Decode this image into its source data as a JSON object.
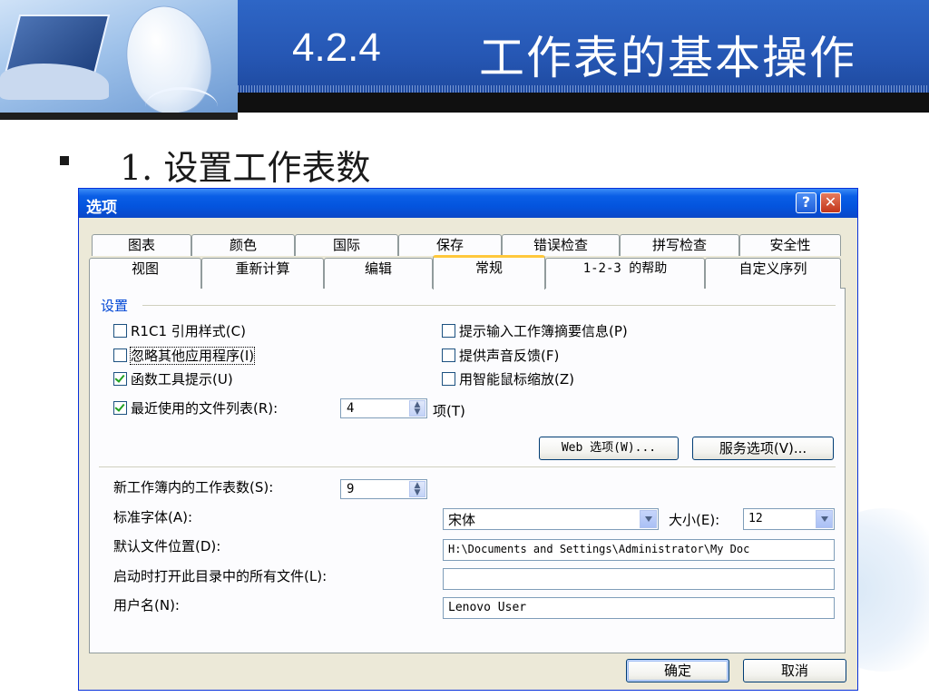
{
  "slide": {
    "title_number": "4.2.4",
    "title_text": "工作表的基本操作",
    "bullet": "1. 设置工作表数"
  },
  "dialog": {
    "title": "选项",
    "help_glyph": "?",
    "close_glyph": "✕",
    "tabs_back": [
      "图表",
      "颜色",
      "国际",
      "保存",
      "错误检查",
      "拼写检查",
      "安全性"
    ],
    "tabs_front": [
      "视图",
      "重新计算",
      "编辑",
      "常规",
      "1-2-3 的帮助",
      "自定义序列"
    ],
    "active_tab": "常规",
    "group_title": "设置",
    "checkboxes": [
      {
        "label": "R1C1 引用样式(C)",
        "checked": false
      },
      {
        "label": "忽略其他应用程序(I)",
        "checked": false
      },
      {
        "label": "函数工具提示(U)",
        "checked": true
      },
      {
        "label": "最近使用的文件列表(R):",
        "checked": true
      },
      {
        "label": "提示输入工作簿摘要信息(P)",
        "checked": false
      },
      {
        "label": "提供声音反馈(F)",
        "checked": false
      },
      {
        "label": "用智能鼠标缩放(Z)",
        "checked": false
      }
    ],
    "recent_files_count": "4",
    "recent_files_unit": "项(T)",
    "web_options_button": "Web 选项(W)...",
    "service_options_button": "服务选项(V)...",
    "sheets_label": "新工作簿内的工作表数(S):",
    "sheets_value": "9",
    "font_label": "标准字体(A):",
    "font_value": "宋体",
    "size_label": "大小(E):",
    "size_value": "12",
    "default_location_label": "默认文件位置(D):",
    "default_location_value": "H:\\Documents and Settings\\Administrator\\My Doc",
    "startup_label": "启动时打开此目录中的所有文件(L):",
    "startup_value": "",
    "username_label": "用户名(N):",
    "username_value": "Lenovo User",
    "ok_button": "确定",
    "cancel_button": "取消"
  },
  "colors": {
    "title_bar_blue": "#2657b4",
    "xp_titlebar": "#0454de",
    "dialog_face": "#ece9d8",
    "group_title_blue": "#0046d5",
    "active_tab_accent": "#ffc83c"
  }
}
